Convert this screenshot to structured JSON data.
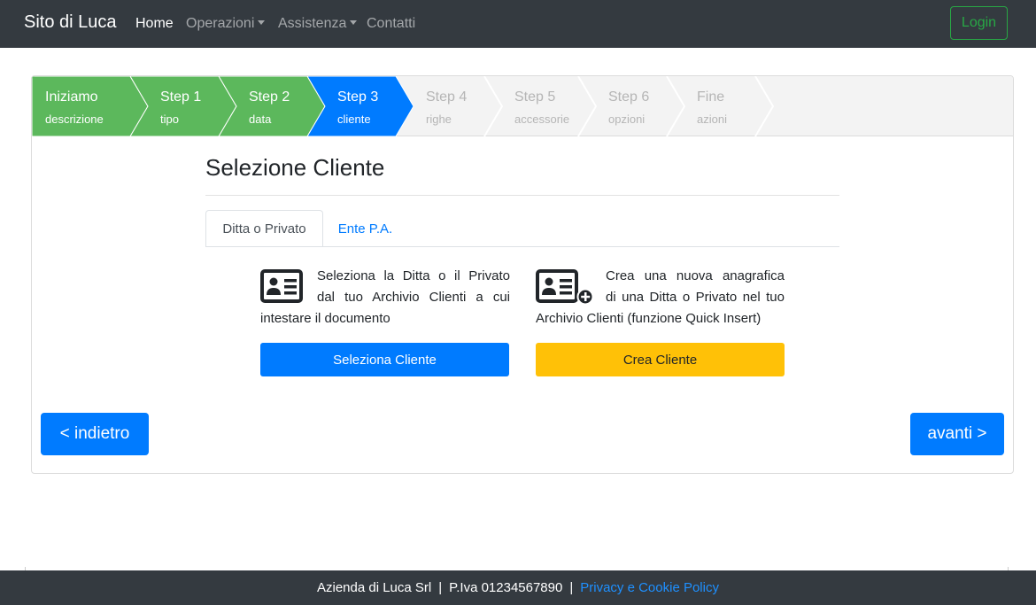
{
  "navbar": {
    "brand": "Sito di Luca",
    "items": [
      {
        "label": "Home",
        "active": true
      },
      {
        "label": "Operazioni",
        "dropdown": true
      },
      {
        "label": "Assistenza",
        "dropdown": true
      },
      {
        "label": "Contatti"
      }
    ],
    "login_label": "Login"
  },
  "steps": [
    {
      "label": "Iniziamo",
      "sub": "descrizione",
      "state": "done"
    },
    {
      "label": "Step 1",
      "sub": "tipo",
      "state": "done"
    },
    {
      "label": "Step 2",
      "sub": "data",
      "state": "done"
    },
    {
      "label": "Step 3",
      "sub": "cliente",
      "state": "current"
    },
    {
      "label": "Step 4",
      "sub": "righe",
      "state": "todo"
    },
    {
      "label": "Step 5",
      "sub": "accessorie",
      "state": "todo"
    },
    {
      "label": "Step 6",
      "sub": "opzioni",
      "state": "todo"
    },
    {
      "label": "Fine",
      "sub": "azioni",
      "state": "todo"
    }
  ],
  "colors": {
    "done": "#5cb85c",
    "current": "#007bff",
    "todo": "#f3f3f3",
    "primary": "#007bff",
    "warning": "#ffc107",
    "success": "#28a745"
  },
  "main": {
    "title": "Selezione Cliente",
    "tabs": [
      {
        "label": "Ditta o Privato",
        "active": true
      },
      {
        "label": "Ente P.A.",
        "active": false
      }
    ],
    "select": {
      "icon": "id-card-icon",
      "text_line1": "Seleziona la Ditta o il Privato",
      "text_line2": "dal tuo Archivio Clienti a cui",
      "text_line3": "intestare il documento",
      "button": "Seleziona Cliente"
    },
    "create": {
      "icon": "id-card-plus-icon",
      "text_line1": "Crea una nuova anagrafica",
      "text_line2": "di una Ditta o Privato nel tuo",
      "text_line3": "Archivio Clienti (funzione Quick Insert)",
      "button": "Crea Cliente"
    },
    "back_button": "< indietro",
    "next_button": "avanti >"
  },
  "footer": {
    "company": "Azienda di Luca Srl",
    "vat": "P.Iva 01234567890",
    "separator": "|",
    "policy_link": "Privacy e Cookie Policy"
  }
}
